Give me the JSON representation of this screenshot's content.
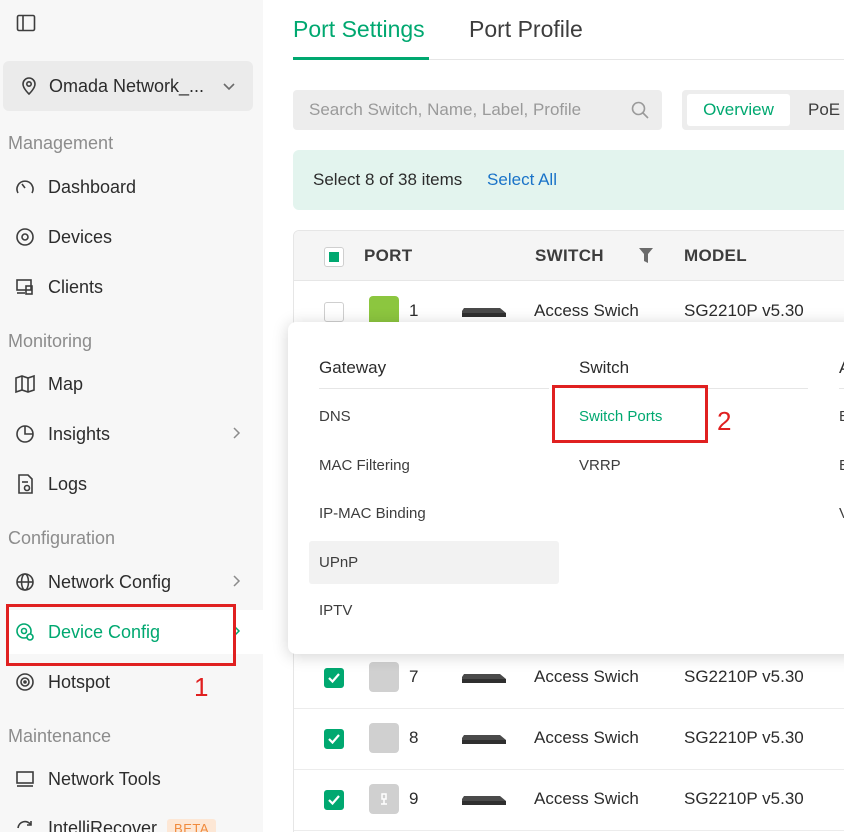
{
  "sidebar": {
    "site": "Omada Network_...",
    "sections": {
      "management": "Management",
      "monitoring": "Monitoring",
      "configuration": "Configuration",
      "maintenance": "Maintenance"
    },
    "items": {
      "dashboard": "Dashboard",
      "devices": "Devices",
      "clients": "Clients",
      "map": "Map",
      "insights": "Insights",
      "logs": "Logs",
      "network_config": "Network Config",
      "device_config": "Device Config",
      "hotspot": "Hotspot",
      "network_tools": "Network Tools",
      "intellirecover": "IntelliRecover",
      "beta": "BETA"
    }
  },
  "tabs": {
    "port_settings": "Port Settings",
    "port_profile": "Port Profile"
  },
  "search": {
    "placeholder": "Search Switch, Name, Label, Profile"
  },
  "view_toggle": {
    "overview": "Overview",
    "poe": "PoE"
  },
  "selection": {
    "text": "Select 8 of 38 items",
    "select_all": "Select All"
  },
  "table": {
    "headers": {
      "port": "PORT",
      "switch": "SWITCH",
      "model": "MODEL"
    },
    "rows": [
      {
        "port": "1",
        "switch": "Access Swich",
        "model": "SG2210P v5.30"
      },
      {
        "port": "7",
        "switch": "Access Swich",
        "model": "SG2210P v5.30"
      },
      {
        "port": "8",
        "switch": "Access Swich",
        "model": "SG2210P v5.30"
      },
      {
        "port": "9",
        "switch": "Access Swich",
        "model": "SG2210P v5.30"
      }
    ]
  },
  "popup": {
    "gateway": {
      "title": "Gateway",
      "items": [
        "DNS",
        "MAC Filtering",
        "IP-MAC Binding",
        "UPnP",
        "IPTV"
      ]
    },
    "switch": {
      "title": "Switch",
      "items": [
        "Switch Ports",
        "VRRP"
      ]
    },
    "third_col": {
      "title": "A",
      "items": [
        "E",
        "E",
        "V"
      ]
    }
  },
  "annotations": {
    "one": "1",
    "two": "2"
  },
  "colors": {
    "accent": "#00a870",
    "link": "#1a73c8",
    "annotation": "#e02020"
  }
}
